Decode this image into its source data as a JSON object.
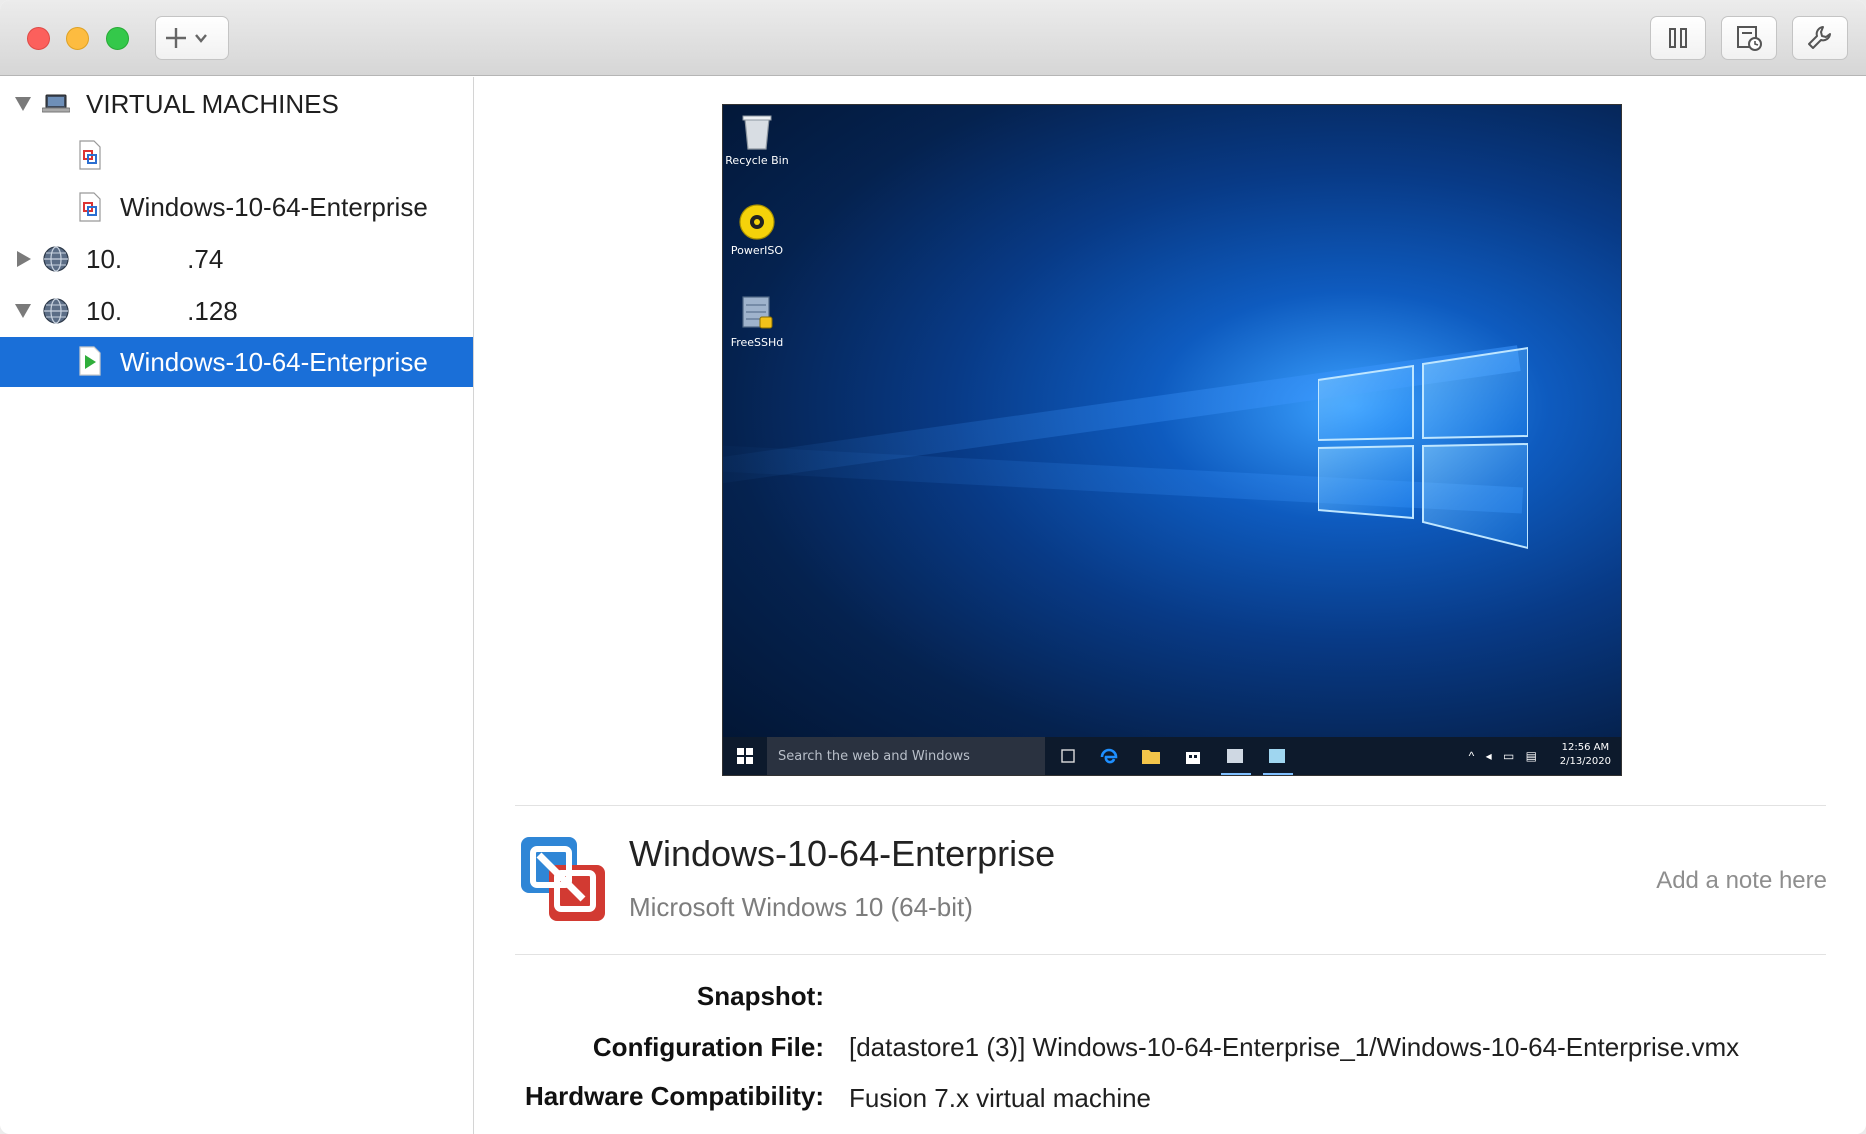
{
  "toolbar": {
    "add_button_icon": "plus-icon",
    "add_button_menu_icon": "chevron-down-icon",
    "right_buttons": [
      "pause-icon",
      "snapshot-icon",
      "settings-wrench-icon"
    ]
  },
  "sidebar": {
    "section_title": "VIRTUAL MACHINES",
    "items": [
      {
        "label": "",
        "icon": "vm-file-icon"
      },
      {
        "label": "Windows-10-64-Enterprise",
        "icon": "vm-file-icon"
      },
      {
        "label": "10.         .74",
        "icon": "globe-server-icon"
      },
      {
        "label": "10.         .128",
        "icon": "globe-server-icon"
      },
      {
        "label": "Windows-10-64-Enterprise",
        "icon": "vm-running-icon",
        "selected": true
      }
    ]
  },
  "preview": {
    "desktop_icons": [
      "Recycle Bin",
      "PowerISO",
      "FreeSSHd"
    ],
    "taskbar_search": "Search the web and Windows",
    "time": "12:56 AM",
    "date": "2/13/2020"
  },
  "vm": {
    "name": "Windows-10-64-Enterprise",
    "os": "Microsoft Windows 10 (64-bit)",
    "note_placeholder": "Add a note here"
  },
  "properties": [
    {
      "label": "Snapshot:",
      "value": ""
    },
    {
      "label": "Configuration File:",
      "value": "[datastore1 (3)] Windows-10-64-Enterprise_1/Windows-10-64-Enterprise.vmx"
    },
    {
      "label": "Hardware Compatibility:",
      "value": "Fusion 7.x virtual machine"
    }
  ],
  "colors": {
    "selection": "#1a6fd8",
    "close": "#fc605c",
    "minimize": "#fdbc40",
    "zoom": "#34c84a"
  }
}
